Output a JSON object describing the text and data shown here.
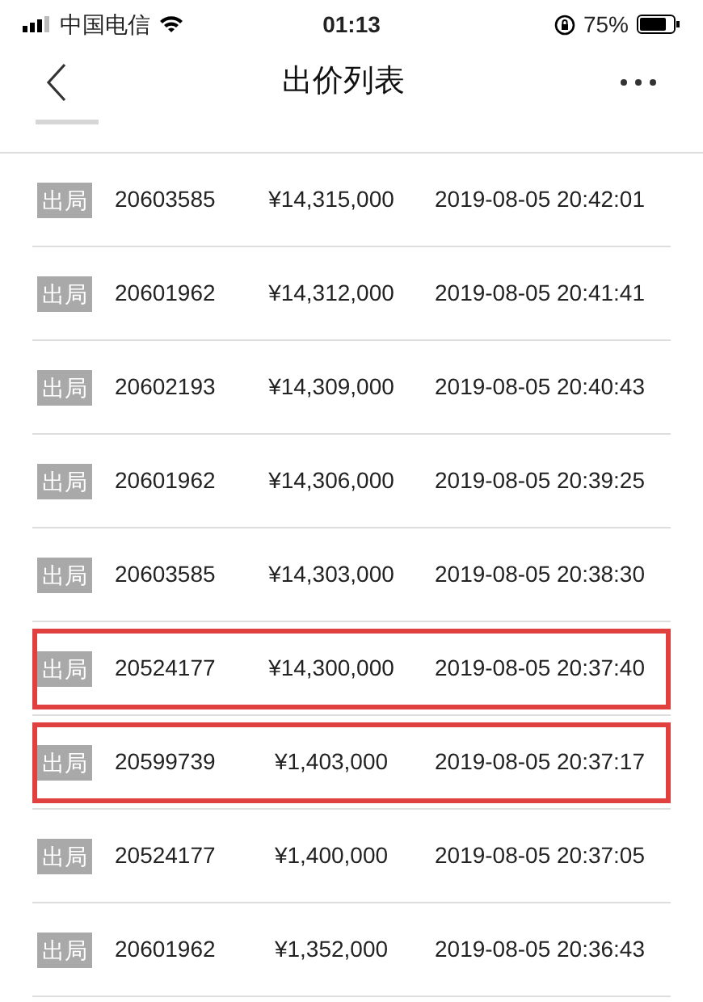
{
  "status_bar": {
    "carrier": "中国电信",
    "time": "01:13",
    "battery": "75%"
  },
  "nav": {
    "title": "出价列表"
  },
  "rows": [
    {
      "badge": "出局",
      "bidder": "20603585",
      "price": "¥14,315,000",
      "time": "2019-08-05 20:42:01",
      "highlighted": false
    },
    {
      "badge": "出局",
      "bidder": "20601962",
      "price": "¥14,312,000",
      "time": "2019-08-05 20:41:41",
      "highlighted": false
    },
    {
      "badge": "出局",
      "bidder": "20602193",
      "price": "¥14,309,000",
      "time": "2019-08-05 20:40:43",
      "highlighted": false
    },
    {
      "badge": "出局",
      "bidder": "20601962",
      "price": "¥14,306,000",
      "time": "2019-08-05 20:39:25",
      "highlighted": false
    },
    {
      "badge": "出局",
      "bidder": "20603585",
      "price": "¥14,303,000",
      "time": "2019-08-05 20:38:30",
      "highlighted": false
    },
    {
      "badge": "出局",
      "bidder": "20524177",
      "price": "¥14,300,000",
      "time": "2019-08-05 20:37:40",
      "highlighted": true
    },
    {
      "badge": "出局",
      "bidder": "20599739",
      "price": "¥1,403,000",
      "time": "2019-08-05 20:37:17",
      "highlighted": true
    },
    {
      "badge": "出局",
      "bidder": "20524177",
      "price": "¥1,400,000",
      "time": "2019-08-05 20:37:05",
      "highlighted": false
    },
    {
      "badge": "出局",
      "bidder": "20601962",
      "price": "¥1,352,000",
      "time": "2019-08-05 20:36:43",
      "highlighted": false
    }
  ]
}
